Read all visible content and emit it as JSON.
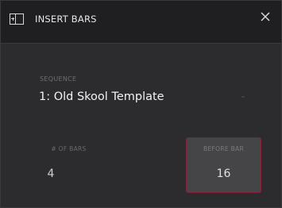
{
  "dialog": {
    "title": "INSERT BARS",
    "icon": "insert-bars-icon",
    "close_icon": "close-icon"
  },
  "sequence": {
    "label": "SEQUENCE",
    "value": "1: Old Skool Template"
  },
  "fields": {
    "num_bars": {
      "label": "# OF BARS",
      "value": "4"
    },
    "before_bar": {
      "label": "BEFORE BAR",
      "value": "16"
    }
  },
  "colors": {
    "background": "#2c2c2e",
    "header": "#1f1f21",
    "selected_border": "#8a1f3b",
    "selected_fill": "#454547"
  }
}
